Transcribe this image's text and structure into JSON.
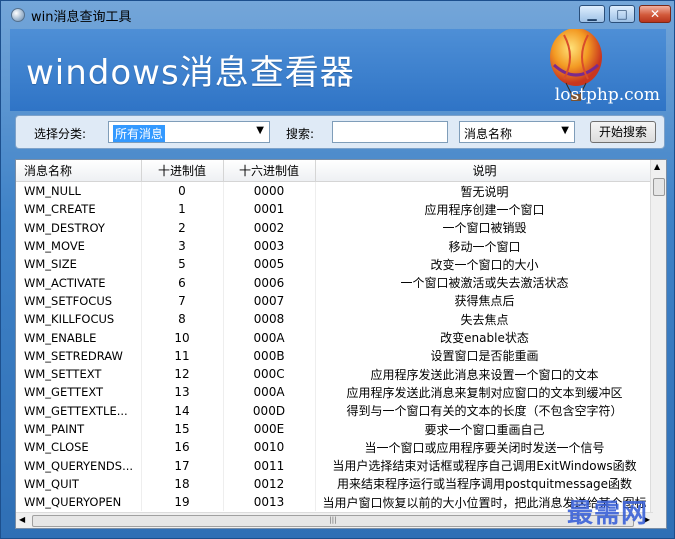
{
  "window": {
    "title": "win消息查询工具",
    "min_icon": "minimize-icon",
    "max_icon": "maximize-icon",
    "close_icon": "close-icon"
  },
  "banner": {
    "title": "windows消息查看器",
    "site": "lostphp.com",
    "graphic": "hot-air-balloon"
  },
  "search": {
    "category_label": "选择分类:",
    "category_value": "所有消息",
    "search_label": "搜索:",
    "search_value": "",
    "field_value": "消息名称",
    "start_button": "开始搜索"
  },
  "table": {
    "headers": [
      "消息名称",
      "十进制值",
      "十六进制值",
      "说明"
    ],
    "rows": [
      [
        "WM_NULL",
        "0",
        "0000",
        "暂无说明"
      ],
      [
        "WM_CREATE",
        "1",
        "0001",
        "应用程序创建一个窗口"
      ],
      [
        "WM_DESTROY",
        "2",
        "0002",
        "一个窗口被销毁"
      ],
      [
        "WM_MOVE",
        "3",
        "0003",
        "移动一个窗口"
      ],
      [
        "WM_SIZE",
        "5",
        "0005",
        "改变一个窗口的大小"
      ],
      [
        "WM_ACTIVATE",
        "6",
        "0006",
        "一个窗口被激活或失去激活状态"
      ],
      [
        "WM_SETFOCUS",
        "7",
        "0007",
        "获得焦点后"
      ],
      [
        "WM_KILLFOCUS",
        "8",
        "0008",
        "失去焦点"
      ],
      [
        "WM_ENABLE",
        "10",
        "000A",
        "改变enable状态"
      ],
      [
        "WM_SETREDRAW",
        "11",
        "000B",
        "设置窗口是否能重画"
      ],
      [
        "WM_SETTEXT",
        "12",
        "000C",
        "应用程序发送此消息来设置一个窗口的文本"
      ],
      [
        "WM_GETTEXT",
        "13",
        "000A",
        "应用程序发送此消息来复制对应窗口的文本到缓冲区"
      ],
      [
        "WM_GETTEXTLE...",
        "14",
        "000D",
        "得到与一个窗口有关的文本的长度（不包含空字符）"
      ],
      [
        "WM_PAINT",
        "15",
        "000E",
        "要求一个窗口重画自己"
      ],
      [
        "WM_CLOSE",
        "16",
        "0010",
        "当一个窗口或应用程序要关闭时发送一个信号"
      ],
      [
        "WM_QUERYENDS...",
        "17",
        "0011",
        "当用户选择结束对话框或程序自己调用ExitWindows函数"
      ],
      [
        "WM_QUIT",
        "18",
        "0012",
        "用来结束程序运行或当程序调用postquitmessage函数"
      ],
      [
        "WM_QUERYOPEN",
        "19",
        "0013",
        "当用户窗口恢复以前的大小位置时，把此消息发送给某个图标"
      ]
    ]
  },
  "watermark": "最需网"
}
